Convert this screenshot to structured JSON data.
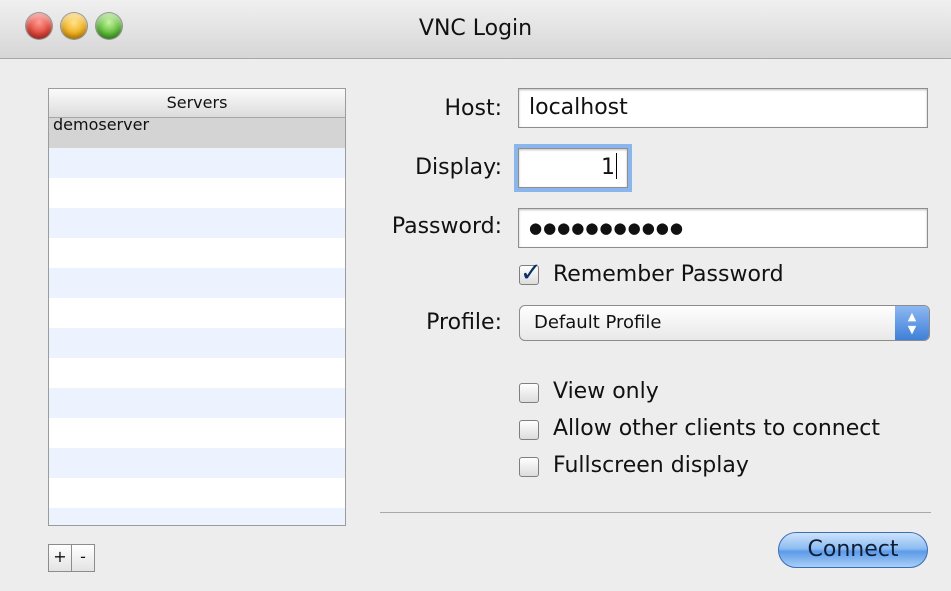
{
  "window": {
    "title": "VNC Login"
  },
  "servers": {
    "header": "Servers",
    "items": [
      "demoserver"
    ]
  },
  "list_buttons": {
    "add": "+",
    "remove": "-"
  },
  "form": {
    "host": {
      "label": "Host:",
      "value": "localhost"
    },
    "display": {
      "label": "Display:",
      "value": "1"
    },
    "password": {
      "label": "Password:",
      "value": "●●●●●●●●●●●"
    },
    "remember_password": {
      "label": "Remember Password",
      "checked": true
    },
    "profile": {
      "label": "Profile:",
      "selected": "Default Profile"
    },
    "options": [
      {
        "label": "View only",
        "checked": false
      },
      {
        "label": "Allow other clients to connect",
        "checked": false
      },
      {
        "label": "Fullscreen display",
        "checked": false
      }
    ]
  },
  "connect_button": "Connect"
}
